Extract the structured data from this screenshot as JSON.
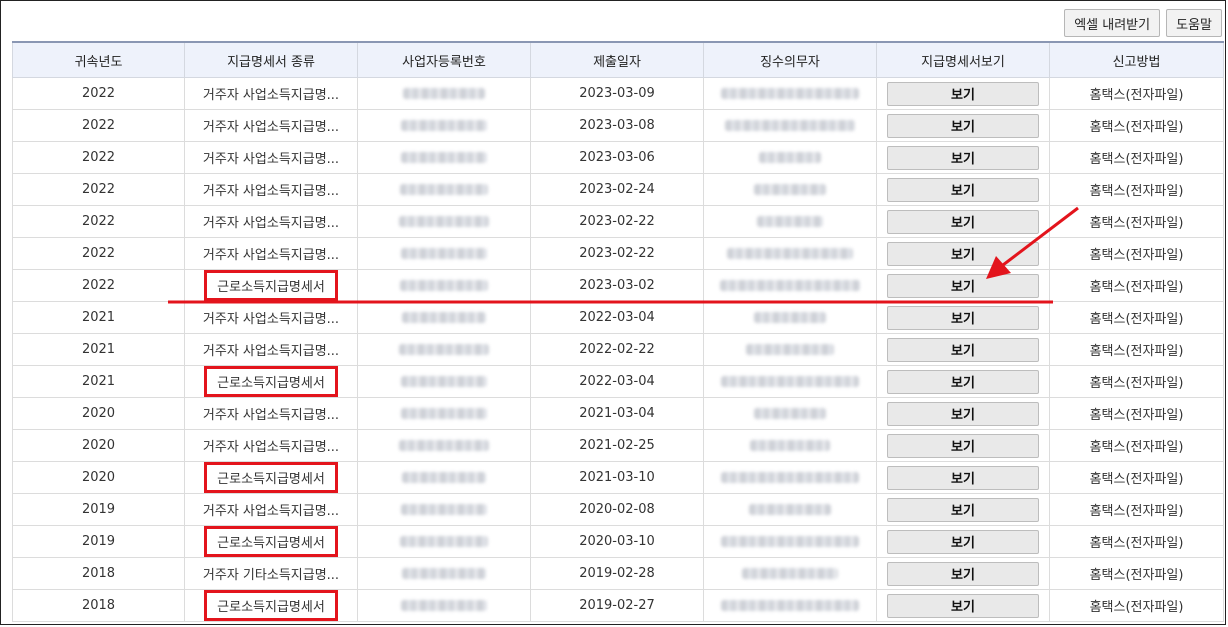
{
  "toolbar": {
    "excel_label": "엑셀 내려받기",
    "help_label": "도움말"
  },
  "columns": [
    "귀속년도",
    "지급명세서 종류",
    "사업자등록번호",
    "제출일자",
    "징수의무자",
    "지급명세서보기",
    "신고방법"
  ],
  "rows": [
    {
      "year": "2022",
      "kind": "거주자 사업소득지급명...",
      "date": "2023-03-09",
      "view": "보기",
      "method": "홈택스(전자파일)",
      "highlight": false
    },
    {
      "year": "2022",
      "kind": "거주자 사업소득지급명...",
      "date": "2023-03-08",
      "view": "보기",
      "method": "홈택스(전자파일)",
      "highlight": false
    },
    {
      "year": "2022",
      "kind": "거주자 사업소득지급명...",
      "date": "2023-03-06",
      "view": "보기",
      "method": "홈택스(전자파일)",
      "highlight": false
    },
    {
      "year": "2022",
      "kind": "거주자 사업소득지급명...",
      "date": "2023-02-24",
      "view": "보기",
      "method": "홈택스(전자파일)",
      "highlight": false
    },
    {
      "year": "2022",
      "kind": "거주자 사업소득지급명...",
      "date": "2023-02-22",
      "view": "보기",
      "method": "홈택스(전자파일)",
      "highlight": false
    },
    {
      "year": "2022",
      "kind": "거주자 사업소득지급명...",
      "date": "2023-02-22",
      "view": "보기",
      "method": "홈택스(전자파일)",
      "highlight": false
    },
    {
      "year": "2022",
      "kind": "근로소득지급명세서",
      "date": "2023-03-02",
      "view": "보기",
      "method": "홈택스(전자파일)",
      "highlight": true
    },
    {
      "year": "2021",
      "kind": "거주자 사업소득지급명...",
      "date": "2022-03-04",
      "view": "보기",
      "method": "홈택스(전자파일)",
      "highlight": false
    },
    {
      "year": "2021",
      "kind": "거주자 사업소득지급명...",
      "date": "2022-02-22",
      "view": "보기",
      "method": "홈택스(전자파일)",
      "highlight": false
    },
    {
      "year": "2021",
      "kind": "근로소득지급명세서",
      "date": "2022-03-04",
      "view": "보기",
      "method": "홈택스(전자파일)",
      "highlight": true
    },
    {
      "year": "2020",
      "kind": "거주자 사업소득지급명...",
      "date": "2021-03-04",
      "view": "보기",
      "method": "홈택스(전자파일)",
      "highlight": false
    },
    {
      "year": "2020",
      "kind": "거주자 사업소득지급명...",
      "date": "2021-02-25",
      "view": "보기",
      "method": "홈택스(전자파일)",
      "highlight": false
    },
    {
      "year": "2020",
      "kind": "근로소득지급명세서",
      "date": "2021-03-10",
      "view": "보기",
      "method": "홈택스(전자파일)",
      "highlight": true
    },
    {
      "year": "2019",
      "kind": "거주자 사업소득지급명...",
      "date": "2020-02-08",
      "view": "보기",
      "method": "홈택스(전자파일)",
      "highlight": false
    },
    {
      "year": "2019",
      "kind": "근로소득지급명세서",
      "date": "2020-03-10",
      "view": "보기",
      "method": "홈택스(전자파일)",
      "highlight": true
    },
    {
      "year": "2018",
      "kind": "거주자 기타소득지급명...",
      "date": "2019-02-28",
      "view": "보기",
      "method": "홈택스(전자파일)",
      "highlight": false
    },
    {
      "year": "2018",
      "kind": "근로소득지급명세서",
      "date": "2019-02-27",
      "view": "보기",
      "method": "홈택스(전자파일)",
      "highlight": true
    }
  ],
  "colors": {
    "annotation": "#e3141c",
    "header_bg": "#eef2fb",
    "button_bg": "#e9e9e9"
  }
}
